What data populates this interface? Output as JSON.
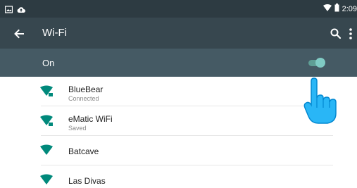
{
  "status_bar": {
    "left_icons": [
      "image-icon",
      "cloud-upload-icon"
    ],
    "right_icons": [
      "wifi-icon",
      "battery-icon"
    ],
    "time": "2:09"
  },
  "app_bar": {
    "title": "Wi-Fi",
    "back_icon": "arrow-back-icon",
    "actions": [
      "search-icon",
      "more-vert-icon"
    ]
  },
  "wifi_toggle": {
    "label": "On",
    "state": "on"
  },
  "networks": [
    {
      "name": "BlueBear",
      "status": "Connected"
    },
    {
      "name": "eMatic WiFi",
      "status": "Saved"
    },
    {
      "name": "Batcave",
      "status": ""
    },
    {
      "name": "Las Divas",
      "status": ""
    }
  ],
  "colors": {
    "status_bar_bg": "#2d3b42",
    "app_bar_bg": "#37474f",
    "toggle_bar_bg": "#455a64",
    "accent": "#00897b",
    "switch_on": "#80cbc4",
    "pointer_hand": "#29b6f6"
  }
}
